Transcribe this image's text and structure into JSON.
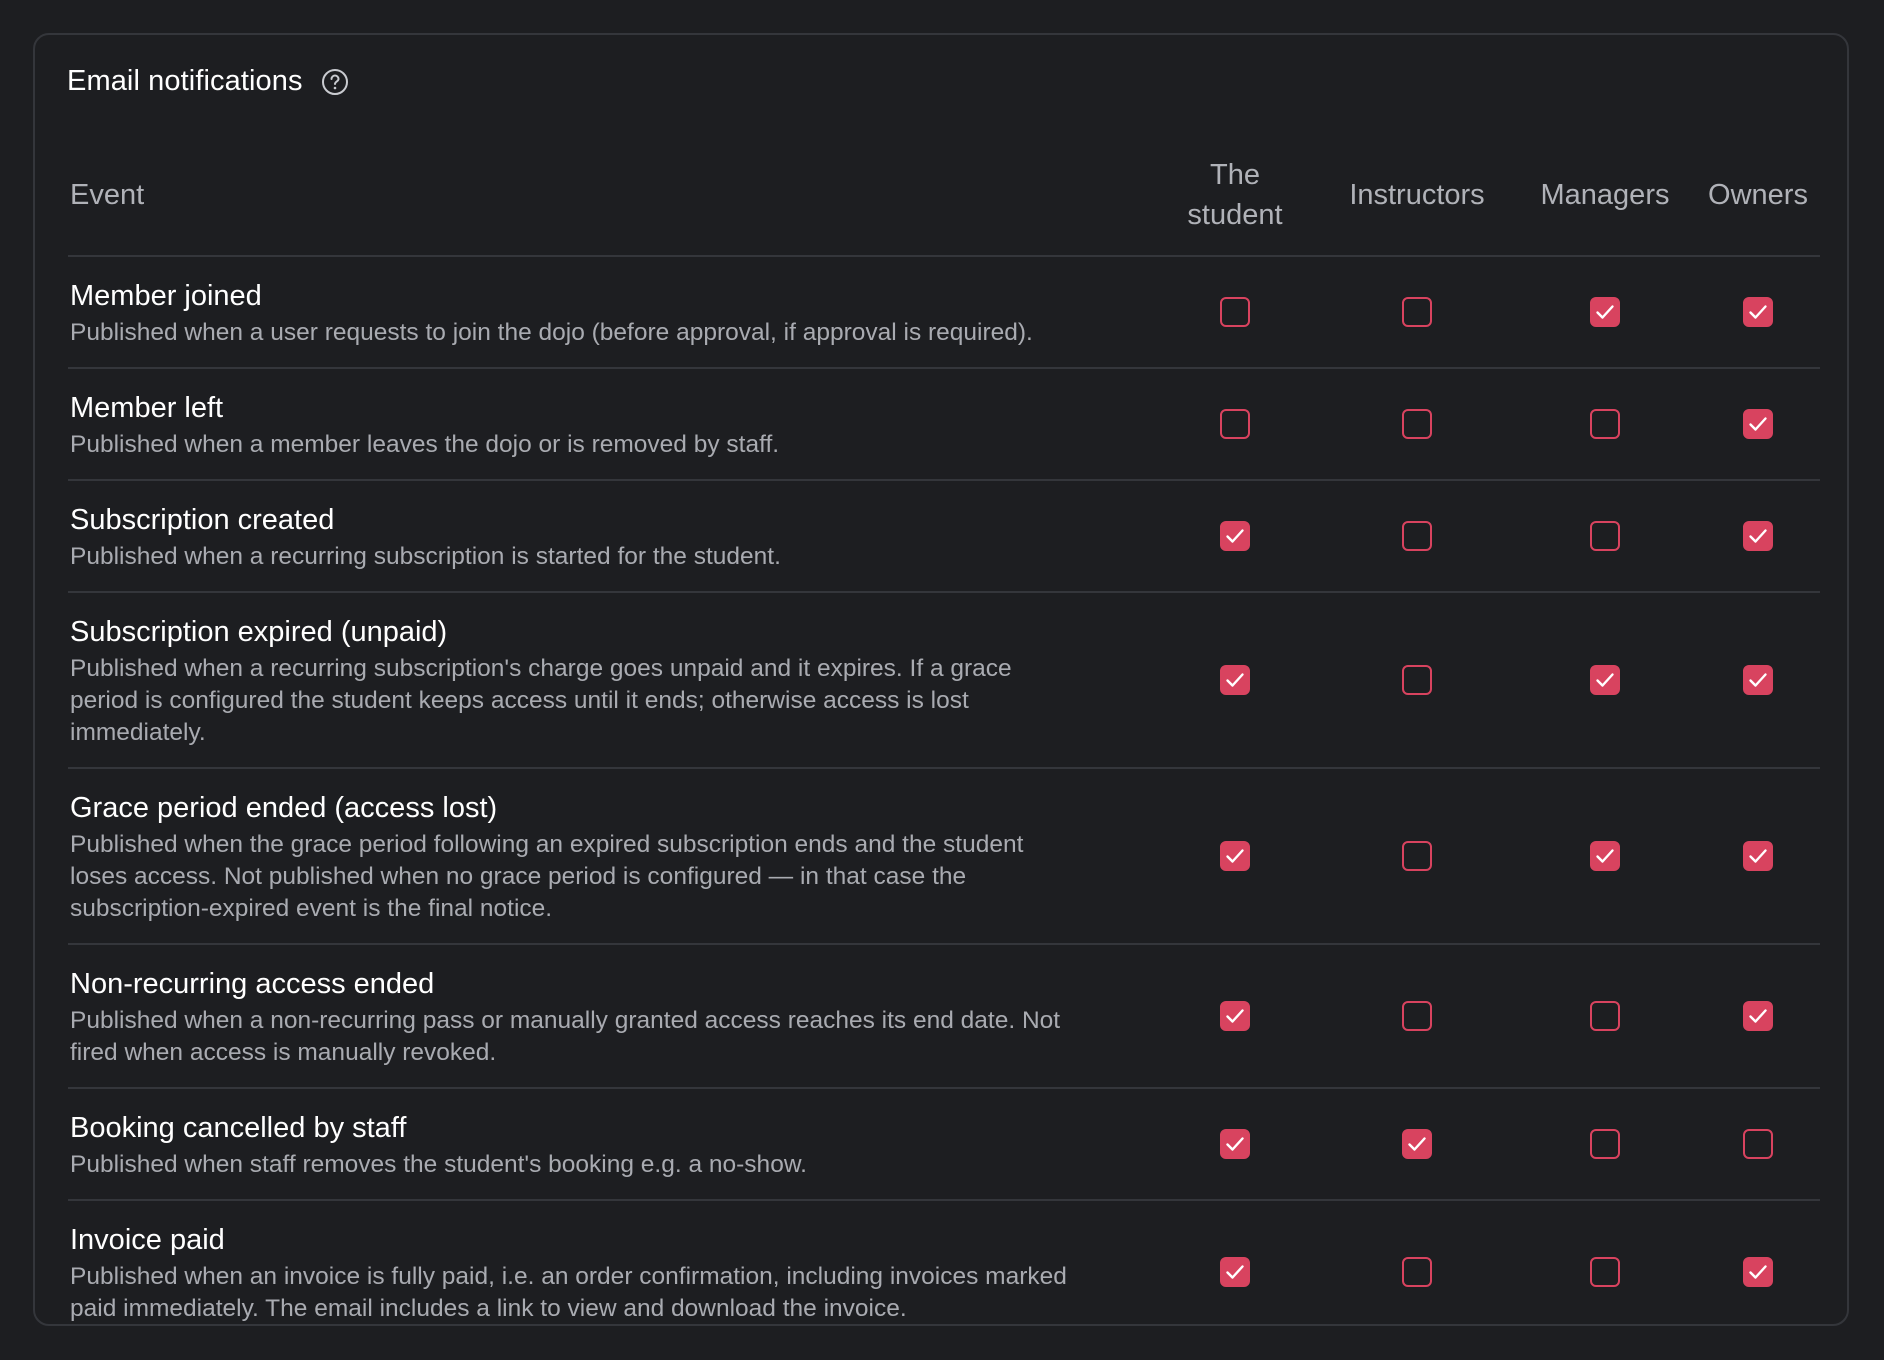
{
  "card": {
    "title": "Email notifications",
    "help_icon": "help-circle-icon"
  },
  "table": {
    "headers": {
      "event": "Event",
      "student": "The student",
      "instructors": "Instructors",
      "managers": "Managers",
      "owners": "Owners"
    },
    "rows": [
      {
        "title": "Member joined",
        "description": "Published when a user requests to join the dojo (before approval, if approval is required).",
        "student": false,
        "instructors": false,
        "managers": true,
        "owners": true
      },
      {
        "title": "Member left",
        "description": "Published when a member leaves the dojo or is removed by staff.",
        "student": false,
        "instructors": false,
        "managers": false,
        "owners": true
      },
      {
        "title": "Subscription created",
        "description": "Published when a recurring subscription is started for the student.",
        "student": true,
        "instructors": false,
        "managers": false,
        "owners": true
      },
      {
        "title": "Subscription expired (unpaid)",
        "description": "Published when a recurring subscription's charge goes unpaid and it expires. If a grace period is configured the student keeps access until it ends; otherwise access is lost immediately.",
        "student": true,
        "instructors": false,
        "managers": true,
        "owners": true
      },
      {
        "title": "Grace period ended (access lost)",
        "description": "Published when the grace period following an expired subscription ends and the student loses access. Not published when no grace period is configured — in that case the subscription-expired event is the final notice.",
        "student": true,
        "instructors": false,
        "managers": true,
        "owners": true
      },
      {
        "title": "Non-recurring access ended",
        "description": "Published when a non-recurring pass or manually granted access reaches its end date. Not fired when access is manually revoked.",
        "student": true,
        "instructors": false,
        "managers": false,
        "owners": true
      },
      {
        "title": "Booking cancelled by staff",
        "description": "Published when staff removes the student's booking e.g. a no-show.",
        "student": true,
        "instructors": true,
        "managers": false,
        "owners": false
      },
      {
        "title": "Invoice paid",
        "description": "Published when an invoice is fully paid, i.e. an order confirmation, including invoices marked paid immediately. The email includes a link to view and download the invoice.",
        "student": true,
        "instructors": false,
        "managers": false,
        "owners": true
      }
    ]
  },
  "colors": {
    "background": "#1d1e21",
    "border": "#34363b",
    "accent": "#d8435f",
    "text": "#ffffff",
    "muted_text": "#a9abb1"
  }
}
